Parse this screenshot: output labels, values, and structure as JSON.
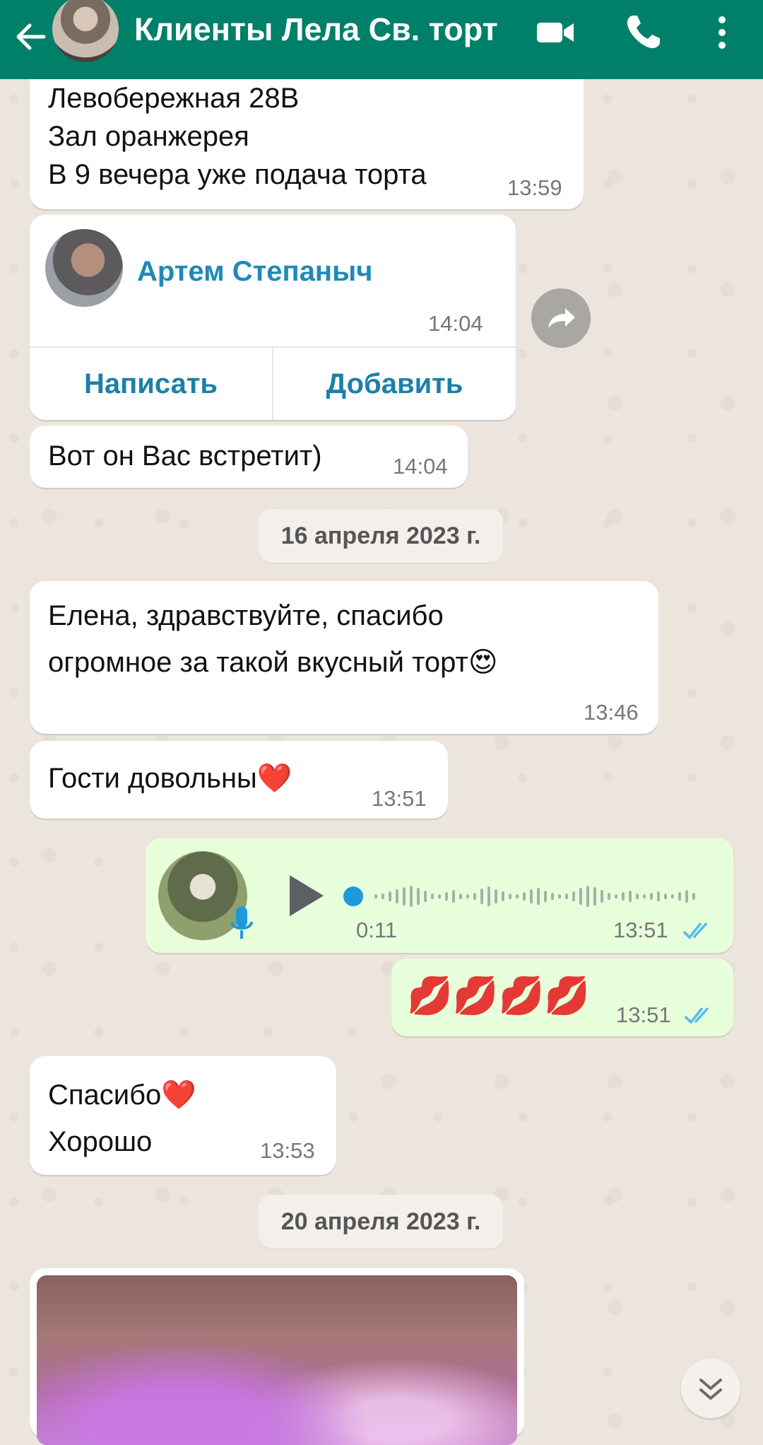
{
  "header": {
    "title": "Клиенты Лела Св. торт",
    "back_icon": "arrow-left-icon",
    "video_icon": "video-camera-icon",
    "call_icon": "phone-icon",
    "menu_icon": "more-vertical-icon",
    "color": "#008069"
  },
  "messages": {
    "m1": {
      "text": "Левобережная 28В\nЗал оранжерея\nВ 9 вечера уже подача торта",
      "time": "13:59"
    },
    "contact": {
      "name": "Артем Степаныч",
      "time": "14:04",
      "write_label": "Написать",
      "add_label": "Добавить"
    },
    "m2": {
      "text": "Вот он Вас встретит)",
      "time": "14:04"
    },
    "date1": "16 апреля 2023 г.",
    "m3": {
      "text": "Елена, здравствуйте, спасибо\nогромное за такой вкусный торт😍",
      "time": "13:46"
    },
    "m4": {
      "text": "Гости довольны❤️",
      "time": "13:51"
    },
    "voice": {
      "duration": "0:11",
      "time": "13:51",
      "status": "read"
    },
    "m5": {
      "text": "💋💋💋💋",
      "time": "13:51",
      "status": "read"
    },
    "m6": {
      "text": "Спасибо❤️\nХорошо",
      "time": "13:53"
    },
    "date2": "20 апреля 2023 г."
  },
  "colors": {
    "outgoing_bubble": "#e7ffdb",
    "incoming_bubble": "#ffffff",
    "read_ticks": "#53bdeb",
    "voice_accent": "#1d9bd8"
  }
}
